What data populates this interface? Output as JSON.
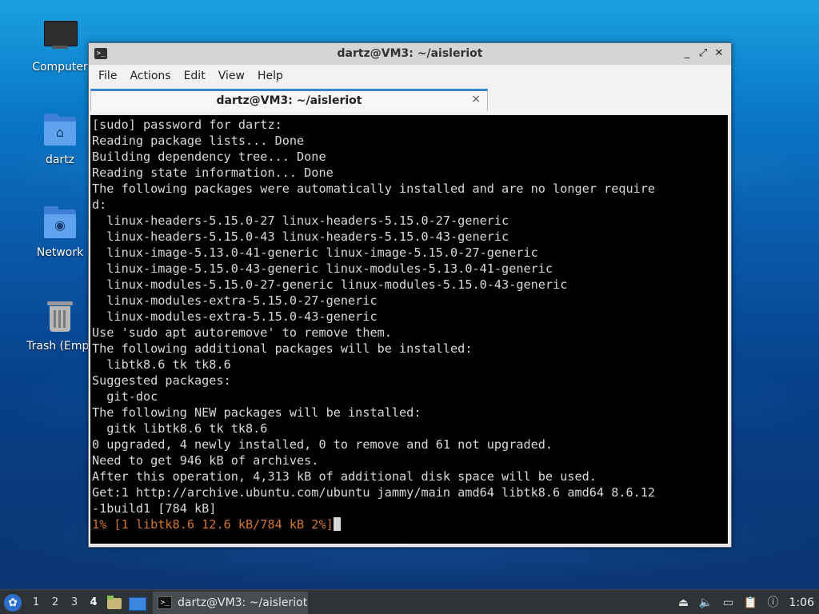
{
  "desktop": {
    "icons": [
      {
        "label": "Computer"
      },
      {
        "label": "dartz"
      },
      {
        "label": "Network"
      },
      {
        "label": "Trash (Empt"
      }
    ]
  },
  "window": {
    "title": "dartz@VM3: ~/aisleriot",
    "controls": {
      "minimize": "_",
      "maximize": "⤢",
      "close": "✕"
    },
    "menu": [
      "File",
      "Actions",
      "Edit",
      "View",
      "Help"
    ],
    "tab": {
      "label": "dartz@VM3: ~/aisleriot",
      "close": "×"
    },
    "terminal": {
      "lines": [
        "[sudo] password for dartz:",
        "Reading package lists... Done",
        "Building dependency tree... Done",
        "Reading state information... Done",
        "The following packages were automatically installed and are no longer require",
        "d:",
        "  linux-headers-5.15.0-27 linux-headers-5.15.0-27-generic",
        "  linux-headers-5.15.0-43 linux-headers-5.15.0-43-generic",
        "  linux-image-5.13.0-41-generic linux-image-5.15.0-27-generic",
        "  linux-image-5.15.0-43-generic linux-modules-5.13.0-41-generic",
        "  linux-modules-5.15.0-27-generic linux-modules-5.15.0-43-generic",
        "  linux-modules-extra-5.15.0-27-generic",
        "  linux-modules-extra-5.15.0-43-generic",
        "Use 'sudo apt autoremove' to remove them.",
        "The following additional packages will be installed:",
        "  libtk8.6 tk tk8.6",
        "Suggested packages:",
        "  git-doc",
        "The following NEW packages will be installed:",
        "  gitk libtk8.6 tk tk8.6",
        "0 upgraded, 4 newly installed, 0 to remove and 61 not upgraded.",
        "Need to get 946 kB of archives.",
        "After this operation, 4,313 kB of additional disk space will be used.",
        "Get:1 http://archive.ubuntu.com/ubuntu jammy/main amd64 libtk8.6 amd64 8.6.12",
        "-1build1 [784 kB]"
      ],
      "progress_line": "1% [1 libtk8.6 12.6 kB/784 kB 2%]"
    }
  },
  "taskbar": {
    "workspaces": [
      "1",
      "2",
      "3",
      "4"
    ],
    "active_workspace": "4",
    "task_label": "dartz@VM3: ~/aisleriot",
    "clock": "1:06"
  },
  "colors": {
    "terminal_bg": "#000000",
    "terminal_fg": "#d8d8d8",
    "progress_fg": "#d2742a",
    "tab_accent": "#3b82d6"
  }
}
